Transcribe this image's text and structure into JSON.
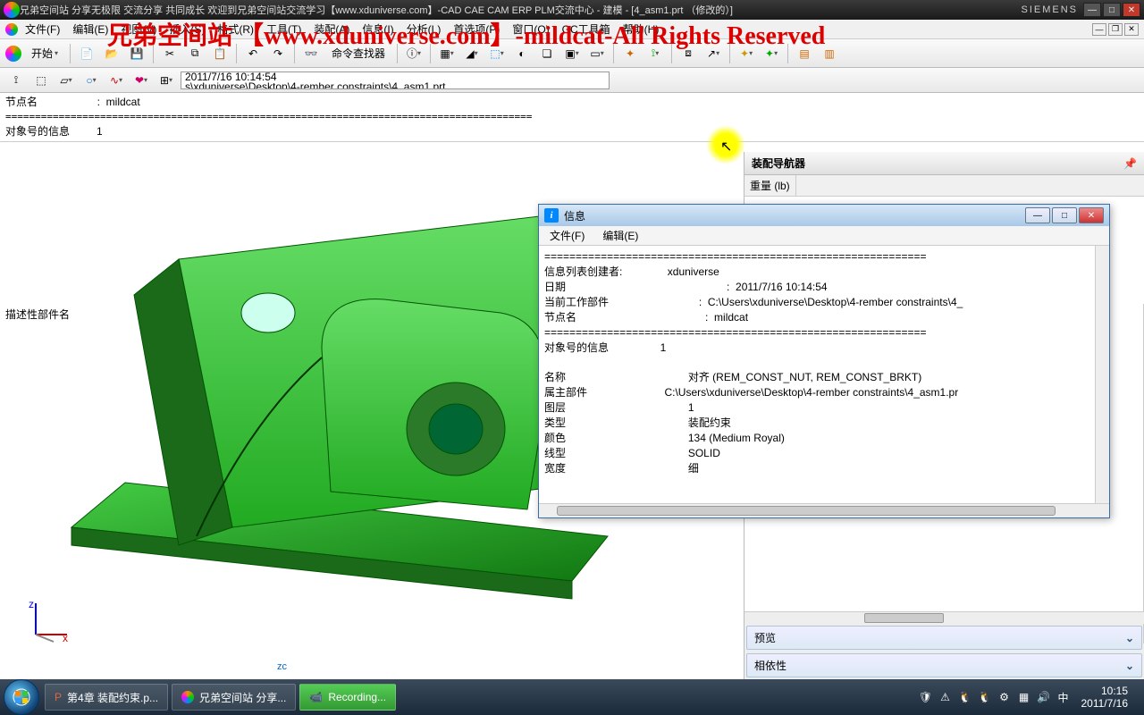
{
  "title": "兄弟空间站 分享无极限 交流分享 共同成长 欢迎到兄弟空间站交流学习【www.xduniverse.com】-CAD CAE CAM ERP PLM交流中心 - 建模 - [4_asm1.prt （修改的）]",
  "brand": "SIEMENS",
  "watermark": "兄弟空间站 【www.xduniverse.com】-mildcat-All Rights Reserved",
  "menu": {
    "file": "文件(F)",
    "edit": "编辑(E)",
    "view": "视图(V)",
    "insert": "插入(S)",
    "format": "格式(R)",
    "tools": "工具(T)",
    "assembly": "装配(A)",
    "info": "信息(I)",
    "analysis": "分析(L)",
    "pref": "首选项(P)",
    "window": "窗口(O)",
    "gc": "GC工具箱",
    "help": "帮助(H)"
  },
  "start_btn": "开始",
  "cmd_finder": "命令查找器",
  "path_line1": "2011/7/16 10:14:54",
  "path_line2": "s\\xduniverse\\Desktop\\4-rember constraints\\4_asm1.prt",
  "top_info_line1": "节点名                    :  mildcat",
  "top_info_line2": "对象号的信息         1",
  "nav": {
    "title": "装配导航器",
    "col1": "描述性部件名",
    "col2": "重量 (lb)",
    "preview": "预览",
    "depend": "相依性"
  },
  "dialog": {
    "title": "信息",
    "file": "文件(F)",
    "edit": "编辑(E)",
    "sep": "=============================================================",
    "l_creator": "信息列表创建者:",
    "v_creator": "xduniverse",
    "l_date": "日期",
    "v_date": ":  2011/7/16 10:14:54",
    "l_curpart": "当前工作部件",
    "v_curpart": ":  C:\\Users\\xduniverse\\Desktop\\4-rember constraints\\4_",
    "l_node": "节点名",
    "v_node": ":  mildcat",
    "l_objinfo": "对象号的信息",
    "v_objinfo": "1",
    "l_name": "名称",
    "v_name": "对齐 (REM_CONST_NUT, REM_CONST_BRKT)",
    "l_owner": "属主部件",
    "v_owner": "C:\\Users\\xduniverse\\Desktop\\4-rember constraints\\4_asm1.pr",
    "l_layer": "图层",
    "v_layer": "1",
    "l_type": "类型",
    "v_type": "装配约束",
    "l_color": "颜色",
    "v_color": "134 (Medium Royal)",
    "l_linetype": "线型",
    "v_linetype": "SOLID",
    "l_width": "宽度",
    "v_width": "细"
  },
  "viewport_label": "zc",
  "taskbar": {
    "ppt": "第4章 装配约束.p...",
    "app": "兄弟空间站 分享...",
    "rec": "Recording...",
    "time": "10:15",
    "date": "2011/7/16"
  }
}
